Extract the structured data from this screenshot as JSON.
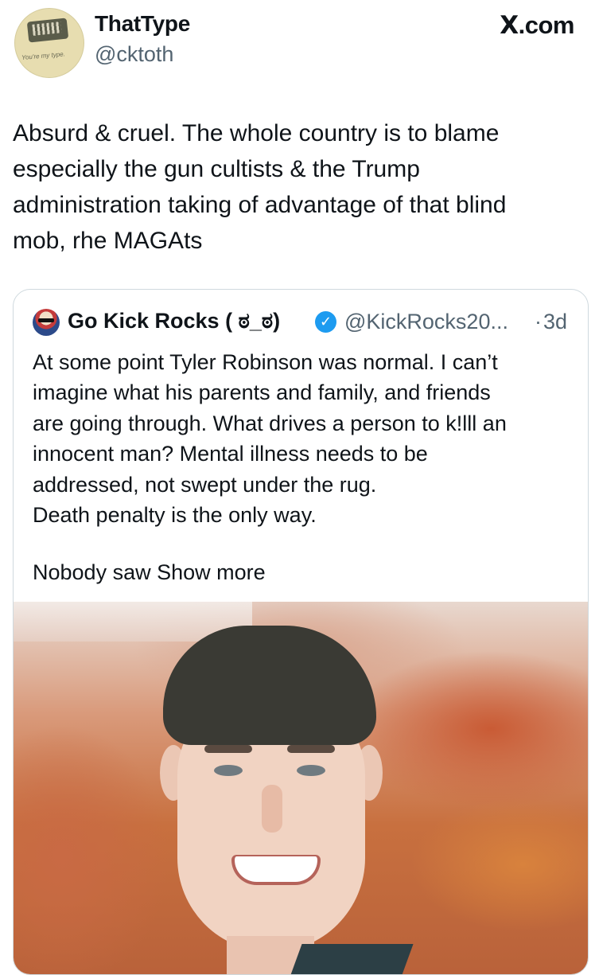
{
  "header": {
    "display_name": "ThatType",
    "handle": "@cktoth",
    "site_label": ".com",
    "site_icon": "X",
    "avatar_caption": "You're my type."
  },
  "tweet": {
    "text": "Absurd & cruel. The whole country is to blame\nespecially the gun cultists & the Trump\nadministration taking of advantage of that blind\nmob, rhe MAGAts"
  },
  "quoted_tweet": {
    "display_name": "Go Kick Rocks ( ಠ_ಠ)",
    "verified_icon": "✓",
    "handle": "@KickRocks20...",
    "separator": "·",
    "time": "3d",
    "text": "At some point Tyler Robinson was normal.   I can’t\nimagine what his parents  and family, and friends\nare going through.   What drives a person to k!lll an\ninnocent man?   Mental illness needs to be\naddressed, not swept under the rug.\nDeath penalty is the only way.",
    "truncated_text": "Nobody saw",
    "show_more": "Show more"
  },
  "icons": {
    "verified": "verified-badge-icon",
    "site": "x-logo-icon"
  },
  "colors": {
    "text_primary": "#0f1419",
    "text_secondary": "#536471",
    "verified_blue": "#1d9bf0",
    "border": "#cfd9de"
  }
}
